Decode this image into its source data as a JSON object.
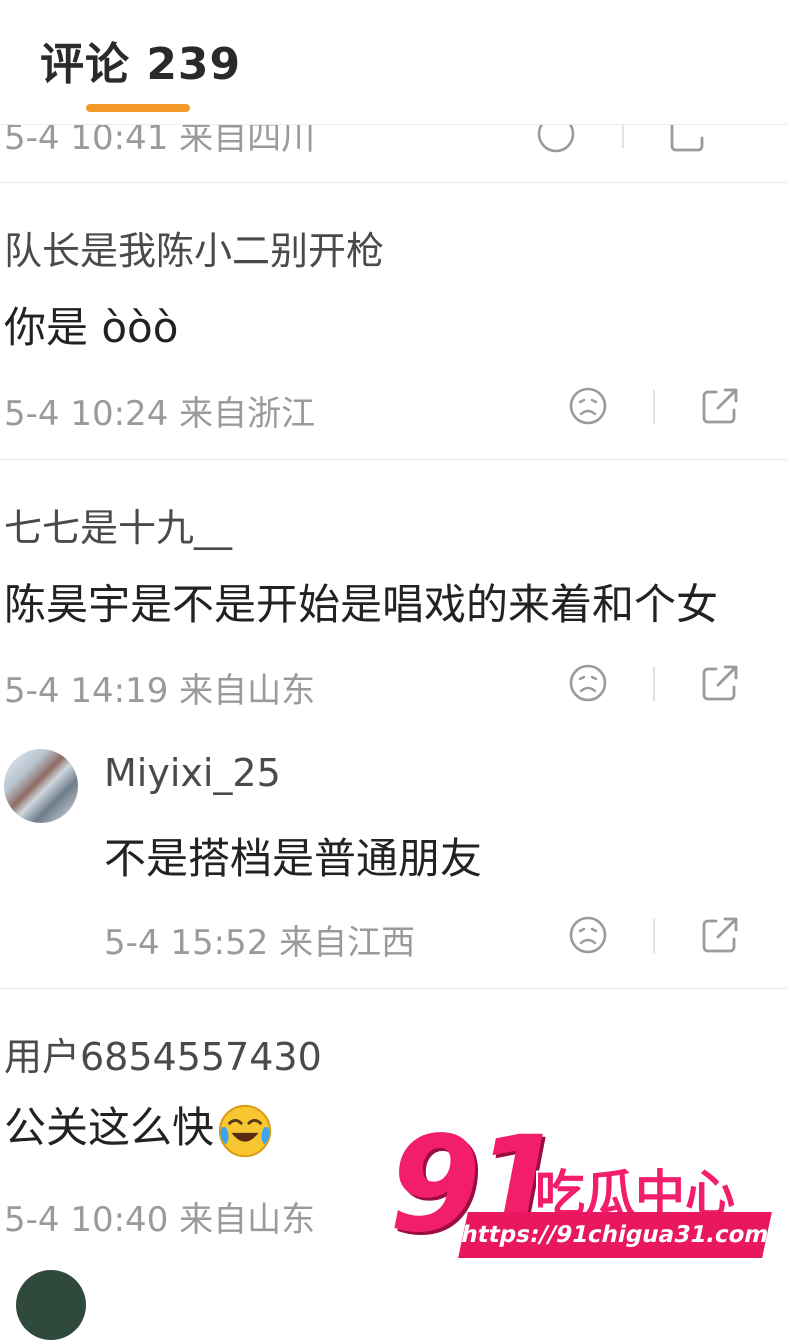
{
  "header": {
    "title": "评论 239"
  },
  "top_cut_meta": {
    "text": "5-4 10:41 来自四川"
  },
  "comments": [
    {
      "username": "队长是我陈小二别开枪",
      "text": "你是 òòò",
      "meta": "5-4 10:24 来自浙江"
    },
    {
      "username": "七七是十九__",
      "text": "陈昊宇是不是开始是唱戏的来着和个女",
      "meta": "5-4 14:19 来自山东"
    },
    {
      "username": "用户6854557430",
      "text": "公关这么快",
      "meta": "5-4 10:40 来自山东"
    }
  ],
  "reply": {
    "username": "Miyixi_25",
    "text": "不是搭档是普通朋友",
    "meta": "5-4 15:52 来自江西"
  },
  "watermark": {
    "number": "91",
    "name": "吃瓜中心",
    "url": "https://91chigua31.com"
  },
  "icons": [
    "sad-face-icon",
    "share-icon",
    "laugh-cry-emoji"
  ]
}
